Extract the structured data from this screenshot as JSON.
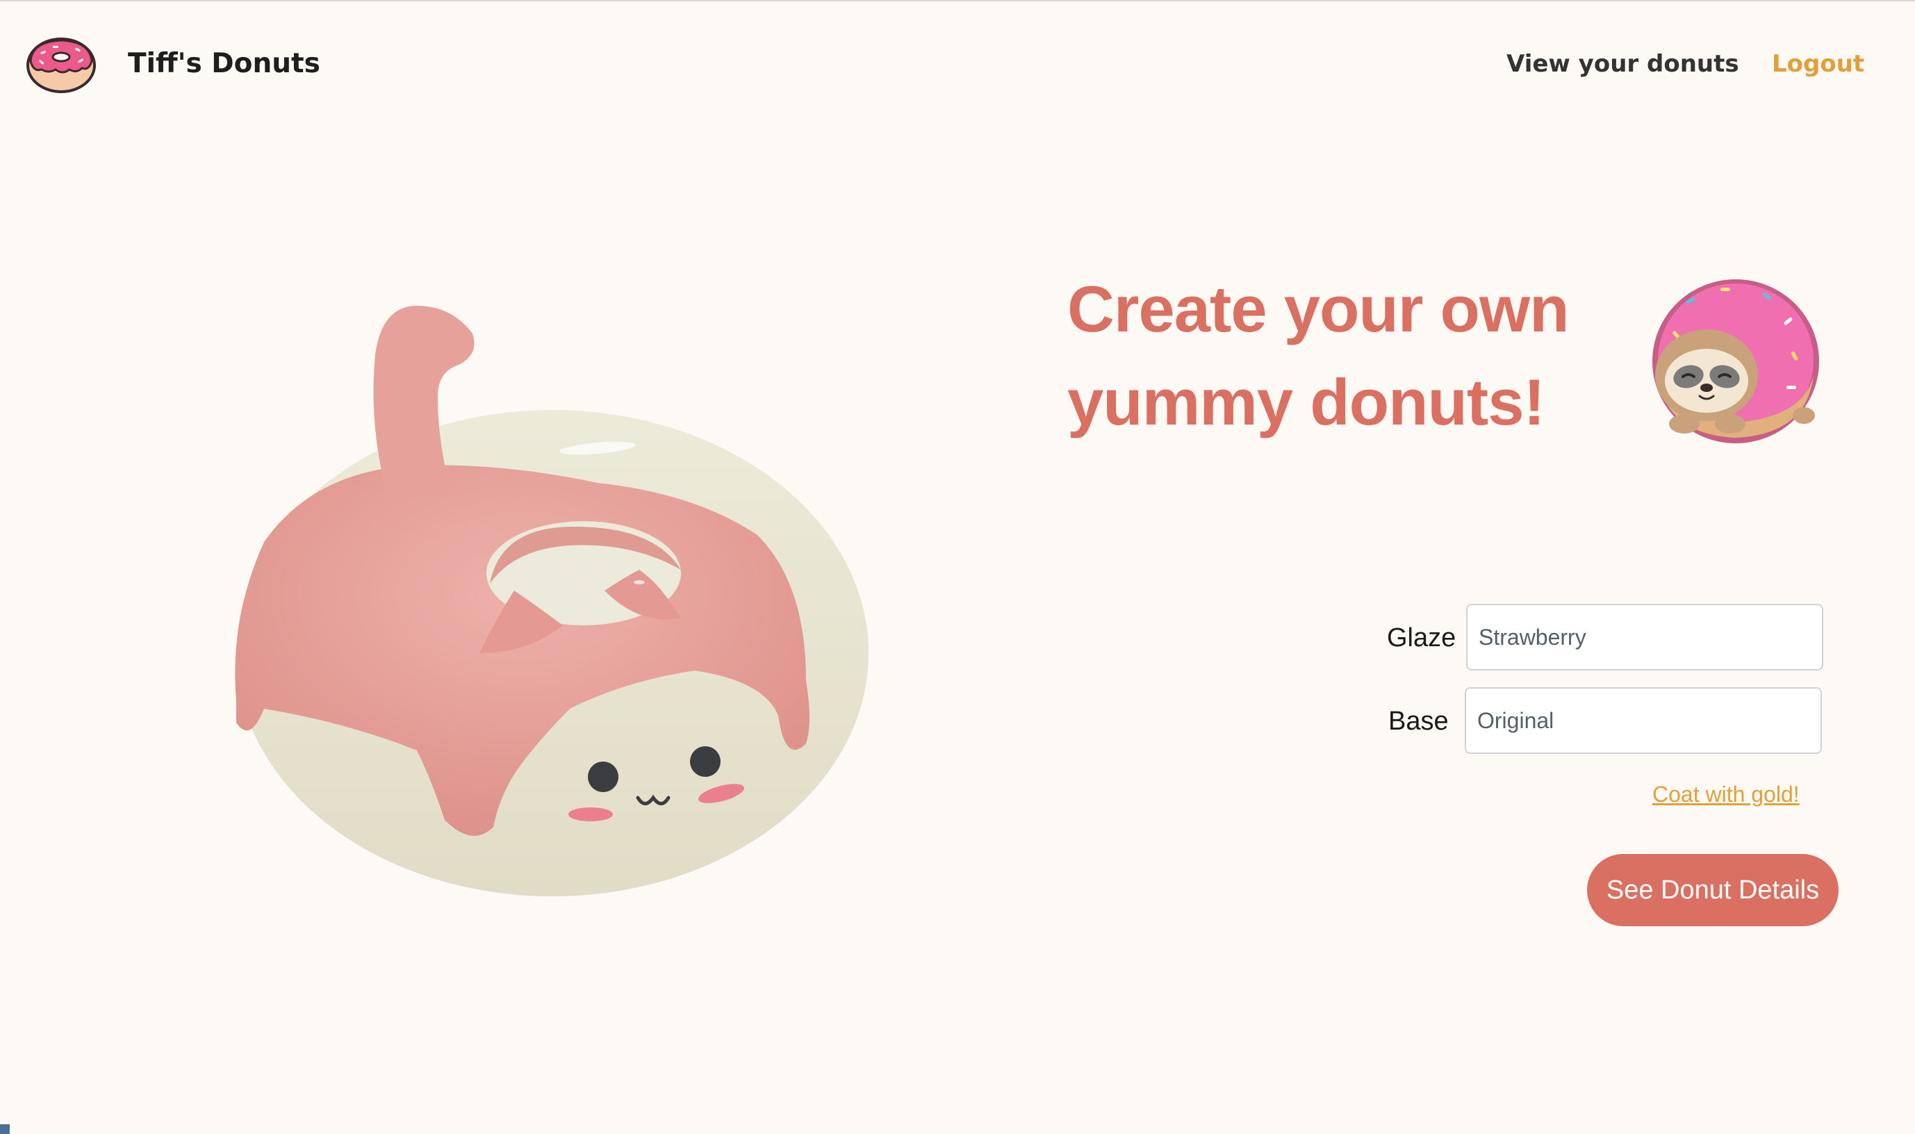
{
  "header": {
    "logo_icon": "pink-donut-icon",
    "brand": "Tiff's Donuts",
    "nav": {
      "view_donuts": "View your donuts",
      "logout": "Logout"
    }
  },
  "hero": {
    "headline": "Create your own yummy donuts!",
    "illustration": "sloth-in-donut-icon",
    "model": "cat-donut-3d-model"
  },
  "form": {
    "glaze": {
      "label": "Glaze",
      "value": "Strawberry"
    },
    "base": {
      "label": "Base",
      "value": "Original"
    },
    "gold_link": "Coat with gold!",
    "submit": "See Donut Details"
  },
  "colors": {
    "background": "#fdf9f4",
    "accent": "#da7062",
    "gold": "#e2a038",
    "glaze_pink": "#e8a8a0",
    "dough_cream": "#e4e1cc"
  }
}
